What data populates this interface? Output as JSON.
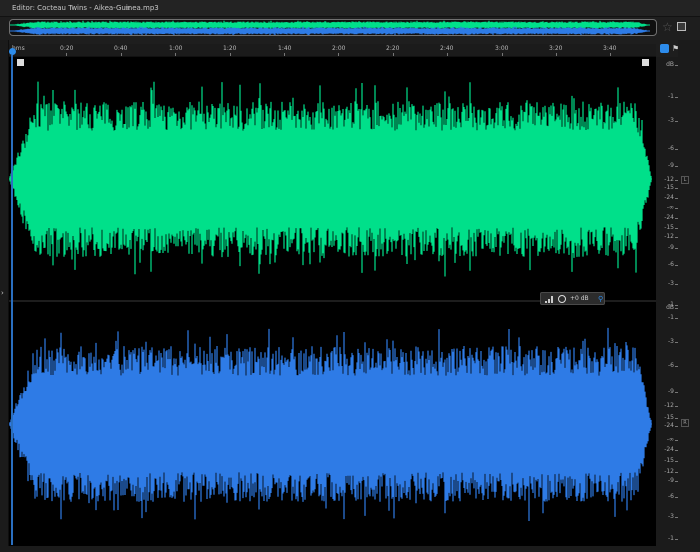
{
  "editor": {
    "title": "Editor: Cocteau Twins - Aikea-Guinea.mp3",
    "menu_icon": "panel-menu-icon"
  },
  "ruler": {
    "ticks": [
      "hms",
      "0:20",
      "0:40",
      "1:00",
      "1:20",
      "1:40",
      "2:00",
      "2:20",
      "2:40",
      "3:00",
      "3:20",
      "3:40"
    ]
  },
  "colors": {
    "left_channel": "#00e08a",
    "right_channel": "#2e7be6",
    "accent": "#2d8ceb"
  },
  "hud": {
    "amplitude": "+0 dB"
  },
  "db_scale": {
    "top_channel": [
      "dB",
      "-1",
      "-3",
      "-6",
      "-9",
      "-12",
      "-15",
      "-24",
      "-∞",
      "-24",
      "-15",
      "-12",
      "-9",
      "-6",
      "-3",
      "-1"
    ],
    "bottom_channel": [
      "dB",
      "-1",
      "-3",
      "-6",
      "-9",
      "-12",
      "-15",
      "-24",
      "-∞",
      "-24",
      "-15",
      "-12",
      "-9",
      "-6",
      "-3",
      "-1"
    ]
  },
  "channels": {
    "left": "L",
    "right": "R"
  },
  "icons": {
    "favorite": "star-icon",
    "panel": "panel-icon",
    "monitor": "headphone-icon",
    "marker": "flag-icon",
    "expand": "chevron-right-icon"
  }
}
